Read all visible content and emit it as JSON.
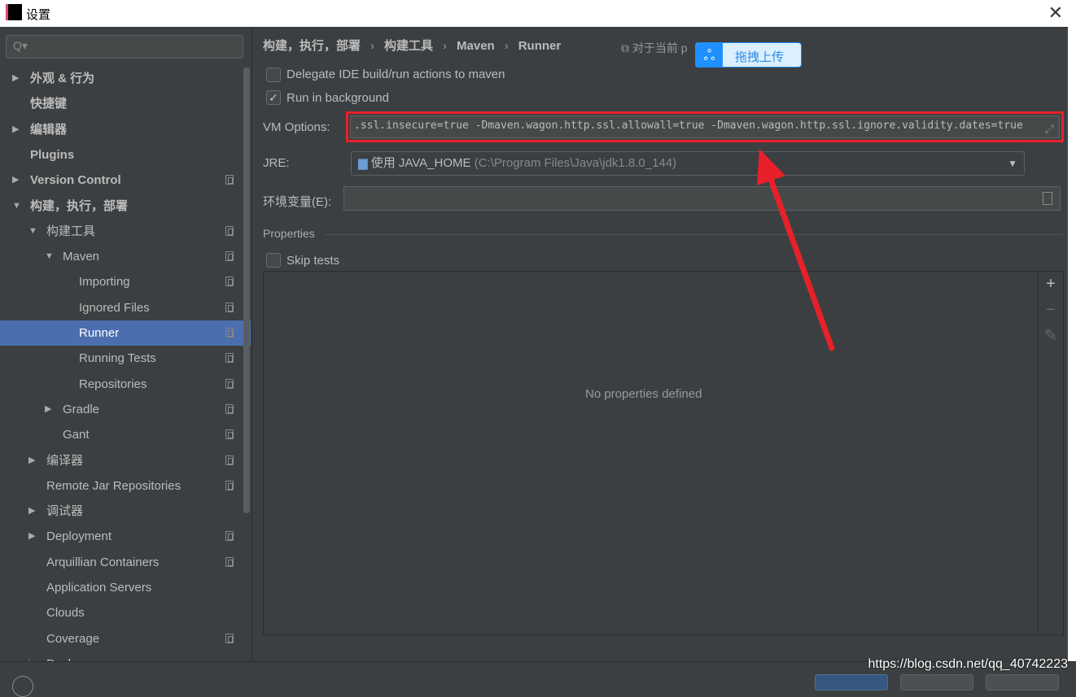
{
  "window": {
    "title": "设置",
    "app_icon_text": "IJ"
  },
  "sidebar": {
    "search_placeholder": "Q▾",
    "items": [
      {
        "label": "外观 & 行为",
        "level": 0,
        "arrow": "▶",
        "bold": true,
        "copy": false
      },
      {
        "label": "快捷键",
        "level": 0,
        "arrow": "",
        "bold": true,
        "copy": false
      },
      {
        "label": "编辑器",
        "level": 0,
        "arrow": "▶",
        "bold": true,
        "copy": false
      },
      {
        "label": "Plugins",
        "level": 0,
        "arrow": "",
        "bold": true,
        "copy": false
      },
      {
        "label": "Version Control",
        "level": 0,
        "arrow": "▶",
        "bold": true,
        "copy": true
      },
      {
        "label": "构建，执行，部署",
        "level": 0,
        "arrow": "▼",
        "bold": true,
        "copy": false
      },
      {
        "label": "构建工具",
        "level": 1,
        "arrow": "▼",
        "copy": true
      },
      {
        "label": "Maven",
        "level": 2,
        "arrow": "▼",
        "copy": true
      },
      {
        "label": "Importing",
        "level": 3,
        "arrow": "",
        "copy": true
      },
      {
        "label": "Ignored Files",
        "level": 3,
        "arrow": "",
        "copy": true
      },
      {
        "label": "Runner",
        "level": 3,
        "arrow": "",
        "copy": true,
        "selected": true
      },
      {
        "label": "Running Tests",
        "level": 3,
        "arrow": "",
        "copy": true
      },
      {
        "label": "Repositories",
        "level": 3,
        "arrow": "",
        "copy": true
      },
      {
        "label": "Gradle",
        "level": 2,
        "arrow": "▶",
        "copy": true
      },
      {
        "label": "Gant",
        "level": 2,
        "arrow": "",
        "copy": true
      },
      {
        "label": "编译器",
        "level": 1,
        "arrow": "▶",
        "copy": true
      },
      {
        "label": "Remote Jar Repositories",
        "level": 1,
        "arrow": "",
        "copy": true
      },
      {
        "label": "调试器",
        "level": 1,
        "arrow": "▶",
        "copy": false
      },
      {
        "label": "Deployment",
        "level": 1,
        "arrow": "▶",
        "copy": true
      },
      {
        "label": "Arquillian Containers",
        "level": 1,
        "arrow": "",
        "copy": true
      },
      {
        "label": "Application Servers",
        "level": 1,
        "arrow": "",
        "copy": false
      },
      {
        "label": "Clouds",
        "level": 1,
        "arrow": "",
        "copy": false
      },
      {
        "label": "Coverage",
        "level": 1,
        "arrow": "",
        "copy": true
      },
      {
        "label": "Docker",
        "level": 1,
        "arrow": "▶",
        "copy": false
      }
    ]
  },
  "breadcrumb": [
    "构建，执行，部署",
    "构建工具",
    "Maven",
    "Runner"
  ],
  "project_hint": "对于当前 p",
  "baidu_overlay": {
    "label": "拖拽上传"
  },
  "runner": {
    "delegate_label": "Delegate IDE build/run actions to maven",
    "delegate_checked": false,
    "background_label": "Run in background",
    "background_checked": true,
    "vm_label": "VM Options:",
    "vm_value": ".ssl.insecure=true -Dmaven.wagon.http.ssl.allowall=true -Dmaven.wagon.http.ssl.ignore.validity.dates=true",
    "jre_label": "JRE:",
    "jre_value": "使用 JAVA_HOME",
    "jre_path": "(C:\\Program Files\\Java\\jdk1.8.0_144)",
    "env_label": "环境变量(E):",
    "env_value": "",
    "properties_title": "Properties",
    "skip_tests_label": "Skip tests",
    "skip_tests_checked": false,
    "empty_text": "No properties defined"
  },
  "annotation_color": "#e8202a",
  "watermark": "https://blog.csdn.net/qq_40742223"
}
